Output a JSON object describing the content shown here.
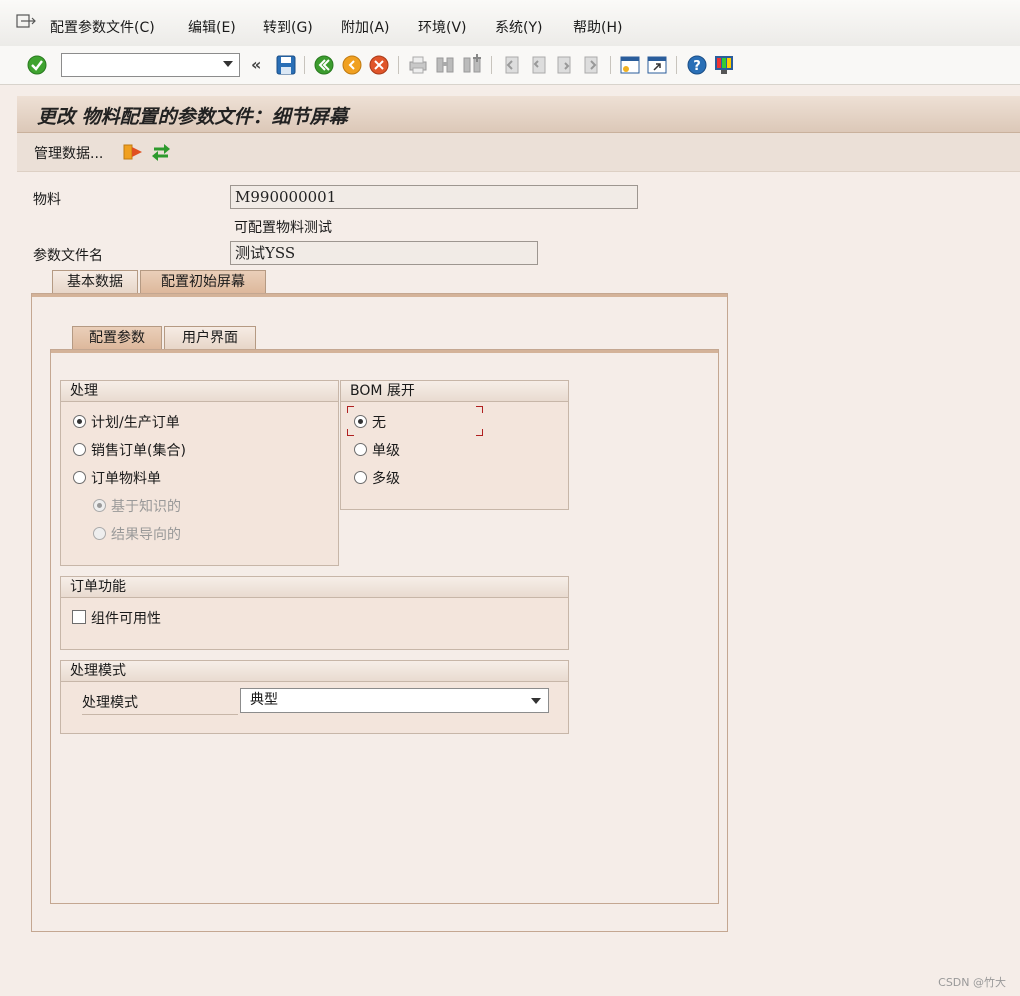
{
  "menu": {
    "items": [
      "配置参数文件(C)",
      "编辑(E)",
      "转到(G)",
      "附加(A)",
      "环境(V)",
      "系统(Y)",
      "帮助(H)"
    ]
  },
  "toolbar": {
    "command_value": "",
    "icons": [
      "enter-icon",
      "back-icon",
      "save-icon",
      "back-green-icon",
      "exit-icon",
      "cancel-icon",
      "print-icon",
      "find-icon",
      "find-next-icon",
      "first-page-icon",
      "prev-page-icon",
      "next-page-icon",
      "last-page-icon",
      "new-session-icon",
      "shortcut-icon",
      "help-icon",
      "customize-icon"
    ]
  },
  "title": "更改 物料配置的参数文件：细节屏幕",
  "app_toolbar": {
    "manage_data_label": "管理数据..."
  },
  "header": {
    "material_label": "物料",
    "material_value": "M990000001",
    "material_desc": "可配置物料测试",
    "profile_label": "参数文件名",
    "profile_value": "测试YSS"
  },
  "outer_tabs": [
    "基本数据",
    "配置初始屏幕"
  ],
  "inner_tabs": [
    "配置参数",
    "用户界面"
  ],
  "processing": {
    "title": "处理",
    "options": [
      {
        "label": "计划/生产订单",
        "selected": true,
        "enabled": true
      },
      {
        "label": "销售订单(集合)",
        "selected": false,
        "enabled": true
      },
      {
        "label": "订单物料单",
        "selected": false,
        "enabled": true
      }
    ],
    "sub_options": [
      {
        "label": "基于知识的",
        "selected": true,
        "enabled": false
      },
      {
        "label": "结果导向的",
        "selected": false,
        "enabled": false
      }
    ]
  },
  "bom": {
    "title": "BOM 展开",
    "options": [
      {
        "label": "无",
        "selected": true
      },
      {
        "label": "单级",
        "selected": false
      },
      {
        "label": "多级",
        "selected": false
      }
    ]
  },
  "order_function": {
    "title": "订单功能",
    "checkbox_label": "组件可用性",
    "checked": false
  },
  "processing_mode": {
    "title": "处理模式",
    "field_label": "处理模式",
    "value": "典型"
  },
  "watermark": "CSDN @竹大"
}
